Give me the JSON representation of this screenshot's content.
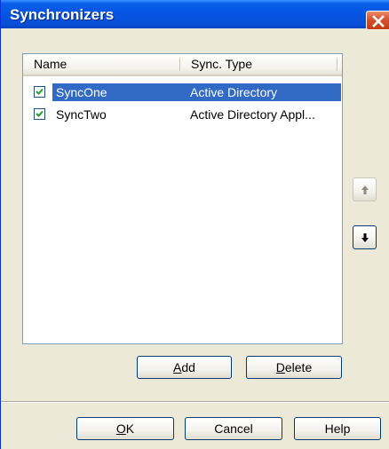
{
  "window": {
    "title": "Synchronizers"
  },
  "list": {
    "columns": [
      "Name",
      "Sync. Type"
    ],
    "rows": [
      {
        "name": "SyncOne",
        "type": "Active Directory",
        "checked": true,
        "selected": true
      },
      {
        "name": "SyncTwo",
        "type": "Active Directory Appl...",
        "checked": true,
        "selected": false
      }
    ]
  },
  "buttons": {
    "add": {
      "label_pre": "",
      "mnemonic": "A",
      "label_post": "dd"
    },
    "delete": {
      "label_pre": "",
      "mnemonic": "D",
      "label_post": "elete"
    },
    "ok": {
      "label_pre": "",
      "mnemonic": "O",
      "label_post": "K"
    },
    "cancel": {
      "label": "Cancel"
    },
    "help": {
      "label": "Help"
    }
  },
  "icons": {
    "close": "close-icon",
    "move_up": "arrow-up-icon",
    "move_down": "arrow-down-icon",
    "checkbox": "check-icon"
  },
  "colors": {
    "title_bar": "#0554e3",
    "selection": "#316ac5",
    "dialog_bg": "#ece9d8",
    "close_button": "#d6522e"
  }
}
